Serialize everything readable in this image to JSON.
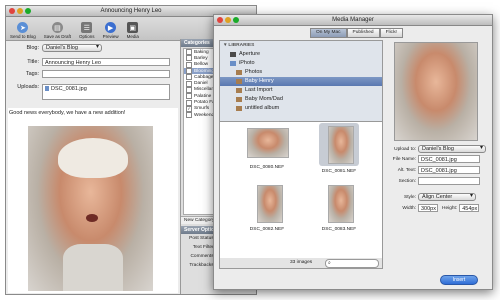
{
  "editor": {
    "title": "Announcing Henry Leo",
    "toolbar": [
      "Send to Blog",
      "Save as Draft",
      "Options",
      "Preview",
      "Media"
    ],
    "blog_label": "Blog:",
    "blog_value": "Daniel's Blog",
    "title_label": "Title:",
    "title_value": "Announcing Henry Leo",
    "tags_label": "Tags:",
    "tags_value": "",
    "uploads_label": "Uploads:",
    "upload_file": "DSC_0081.jpg",
    "body_text": "Good news everybody, we have a new addition!"
  },
  "categories": {
    "header": "Categories",
    "items": [
      {
        "label": "Baking",
        "checked": false
      },
      {
        "label": "Barley",
        "checked": false
      },
      {
        "label": "Bellow",
        "checked": false
      },
      {
        "label": "Blooming",
        "checked": true
      },
      {
        "label": "Cabbage",
        "checked": false
      },
      {
        "label": "Daniel",
        "checked": false
      },
      {
        "label": "Miscellane",
        "checked": false
      },
      {
        "label": "Palatine",
        "checked": false
      },
      {
        "label": "Potato Far",
        "checked": false
      },
      {
        "label": "Smurfs",
        "checked": true
      },
      {
        "label": "Weekend",
        "checked": false
      }
    ],
    "new_category": "New Category",
    "server_header": "Server Options",
    "server_rows": [
      {
        "label": "Post Status:"
      },
      {
        "label": "Text Filter:"
      },
      {
        "label": "Comments:"
      },
      {
        "label": "Trackbacks:"
      }
    ]
  },
  "media": {
    "title": "Media Manager",
    "tabs": [
      "On My Mac",
      "Published",
      "Flickr"
    ],
    "libraries_header": "LIBRARIES",
    "sources": [
      {
        "label": "Aperture",
        "indent": 1
      },
      {
        "label": "iPhoto",
        "indent": 1
      },
      {
        "label": "Photos",
        "indent": 2
      },
      {
        "label": "Baby Henry",
        "indent": 2,
        "selected": true
      },
      {
        "label": "Last Import",
        "indent": 2
      },
      {
        "label": "Baby Mom/Dad",
        "indent": 2
      },
      {
        "label": "untitled album",
        "indent": 2
      }
    ],
    "thumbs": [
      "DSC_0080.NEF",
      "DSC_0081.NEF",
      "DSC_0082.NEF",
      "DSC_0083.NEF"
    ],
    "count": "33 images",
    "upload_to_label": "Upload to:",
    "upload_to_value": "Daniel's Blog",
    "file_name_label": "File Name:",
    "file_name_value": "DSC_0081.jpg",
    "alt_text_label": "Alt. Text:",
    "alt_text_value": "DSC_0081.jpg",
    "section_label": "Section:",
    "style_label": "Style:",
    "style_value": "Align Center",
    "width_label": "Width:",
    "width_value": "300px",
    "height_label": "Height:",
    "height_value": "454px",
    "insert_label": "Insert"
  }
}
